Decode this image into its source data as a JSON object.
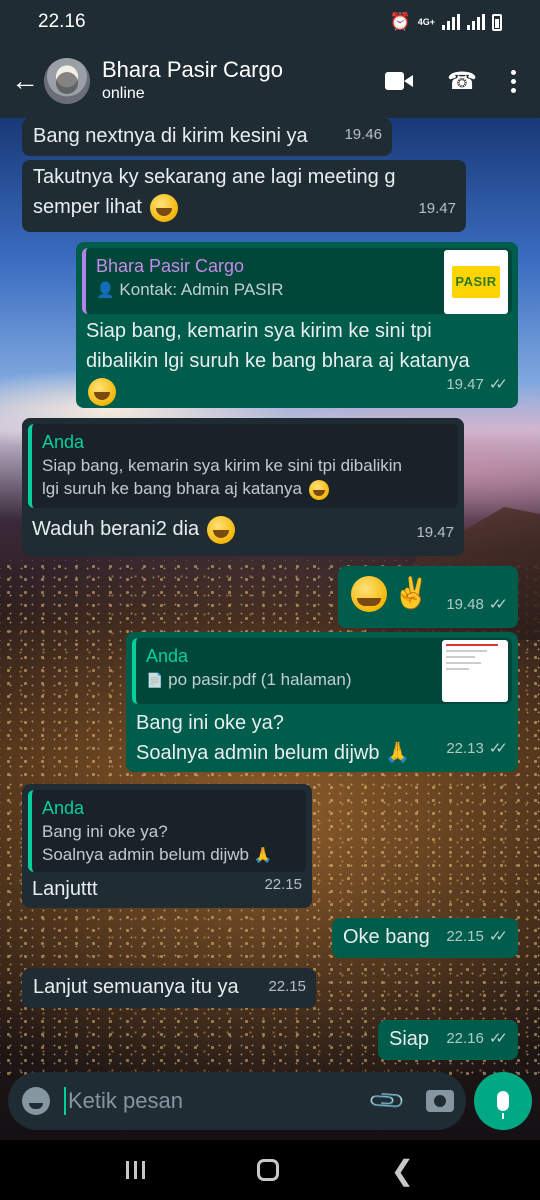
{
  "status_bar": {
    "time": "22.16",
    "network": "4G+"
  },
  "header": {
    "title": "Bhara Pasir Cargo",
    "subtitle": "online"
  },
  "messages": [
    {
      "text": "Bang nextnya di kirim kesini ya",
      "time": "19.46"
    },
    {
      "text_line1": "Takutnya ky sekarang ane lagi meeting g",
      "text_line2": "semper lihat",
      "time": "19.47"
    },
    {
      "quote_author": "Bhara Pasir Cargo",
      "quote_text": "Kontak: Admin PASIR",
      "thumb_label": "PASIR",
      "text_line1": "Siap bang, kemarin sya kirim ke sini tpi",
      "text_line2": "dibalikin lgi suruh ke bang bhara aj katanya",
      "time": "19.47"
    },
    {
      "quote_author": "Anda",
      "quote_line1": "Siap bang, kemarin sya kirim ke sini tpi dibalikin",
      "quote_line2": "lgi suruh ke bang bhara aj katanya",
      "text": "Waduh berani2 dia",
      "time": "19.47"
    },
    {
      "emoji": "✌",
      "time": "19.48"
    },
    {
      "quote_author": "Anda",
      "quote_text": "po pasir.pdf (1 halaman)",
      "text_line1": "Bang ini oke ya?",
      "text_line2": "Soalnya admin belum dijwb",
      "time": "22.13"
    },
    {
      "quote_author": "Anda",
      "quote_line1": "Bang ini oke ya?",
      "quote_line2": "Soalnya admin belum dijwb",
      "text": "Lanjuttt",
      "time": "22.15"
    },
    {
      "text": "Oke bang",
      "time": "22.15"
    },
    {
      "text": "Lanjut semuanya itu ya",
      "time": "22.15"
    },
    {
      "text": "Siap",
      "time": "22.16"
    }
  ],
  "input": {
    "placeholder": "Ketik pesan"
  },
  "colors": {
    "header_bg": "#1f2c34",
    "incoming_bubble": "#1f2c34",
    "outgoing_bubble": "#005c4b",
    "accent": "#00a884"
  }
}
